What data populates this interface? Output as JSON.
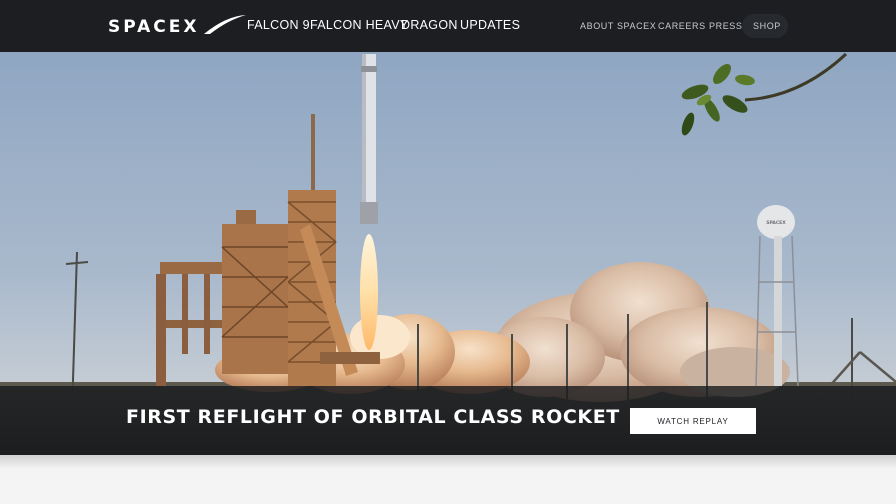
{
  "brand": {
    "logo_text": "SPACEX"
  },
  "nav": {
    "primary": [
      {
        "label": "FALCON 9"
      },
      {
        "label": "FALCON HEAVY"
      },
      {
        "label": "DRAGON"
      },
      {
        "label": "UPDATES"
      }
    ],
    "secondary": [
      {
        "label": "ABOUT SPACEX"
      },
      {
        "label": "CAREERS"
      },
      {
        "label": "PRESS"
      },
      {
        "label": "SHOP"
      }
    ]
  },
  "hero": {
    "headline": "FIRST REFLIGHT OF ORBITAL CLASS ROCKET",
    "cta_label": "WATCH REPLAY",
    "water_tower_text": "SPACEX"
  },
  "colors": {
    "nav_background": "#1c1e22",
    "banner_background": "#18191e",
    "button_background": "#ffffff"
  }
}
